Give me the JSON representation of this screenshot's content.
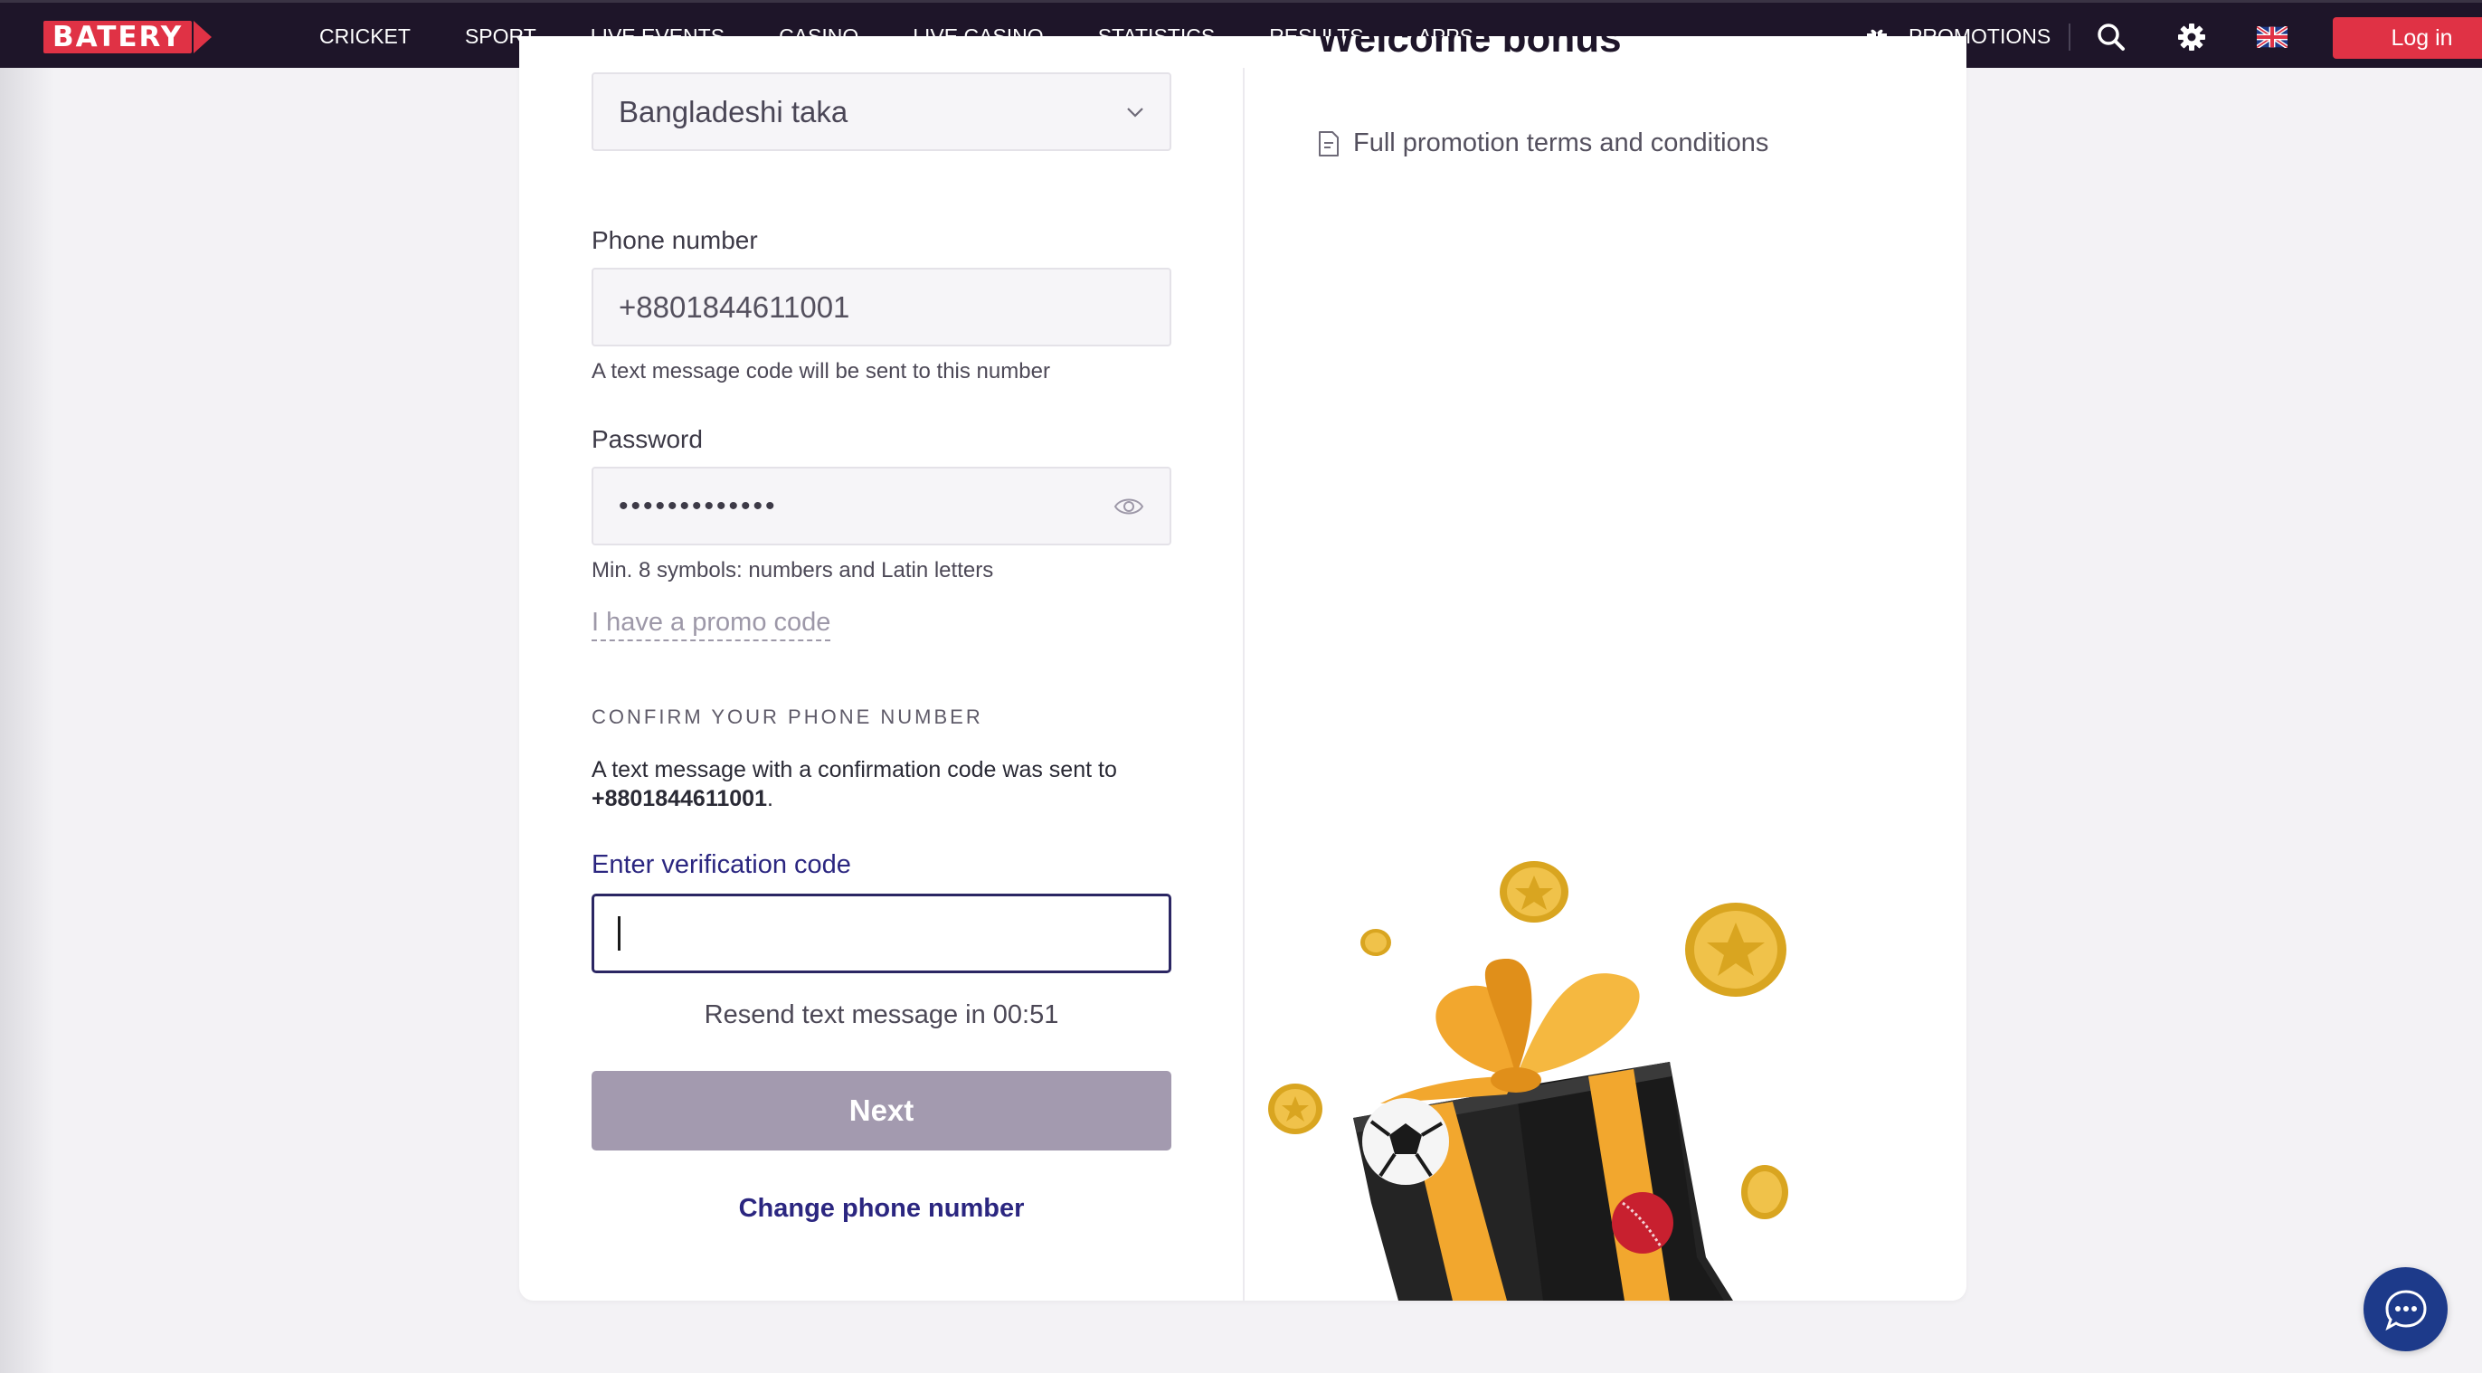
{
  "brand": {
    "logo_text": "BATERY",
    "accent": "#e03245",
    "nav_bg": "#1e1529"
  },
  "nav": {
    "links": [
      "CRICKET",
      "SPORT",
      "LIVE EVENTS",
      "CASINO",
      "LIVE CASINO",
      "STATISTICS",
      "RESULTS",
      "APPS"
    ],
    "promotions": "PROMOTIONS",
    "login": "Log in",
    "icons": [
      "gift-icon",
      "search-icon",
      "gear-icon",
      "uk-flag-icon"
    ]
  },
  "form": {
    "currency": {
      "value": "Bangladeshi taka"
    },
    "phone": {
      "label": "Phone number",
      "value": "+8801844611001",
      "hint": "A text message code will be sent to this number"
    },
    "password": {
      "label": "Password",
      "value": "•••••••••••••",
      "hint": "Min. 8 symbols: numbers and Latin letters"
    },
    "promo_link": "I have a promo code",
    "confirm": {
      "title": "CONFIRM YOUR PHONE NUMBER",
      "text_before": "A text message with a confirmation code was sent to ",
      "phone": "+8801844611001",
      "text_after": "."
    },
    "verify": {
      "label": "Enter verification code",
      "value": ""
    },
    "resend": "Resend text message in 00:51",
    "next": "Next",
    "change_phone": "Change phone number"
  },
  "bonus": {
    "title": "Welcome bonus",
    "terms": "Full promotion terms and conditions"
  },
  "colors": {
    "next_disabled": "#a39aaf",
    "link_blue": "#2b2680",
    "chat_button": "#1d3a8a"
  }
}
